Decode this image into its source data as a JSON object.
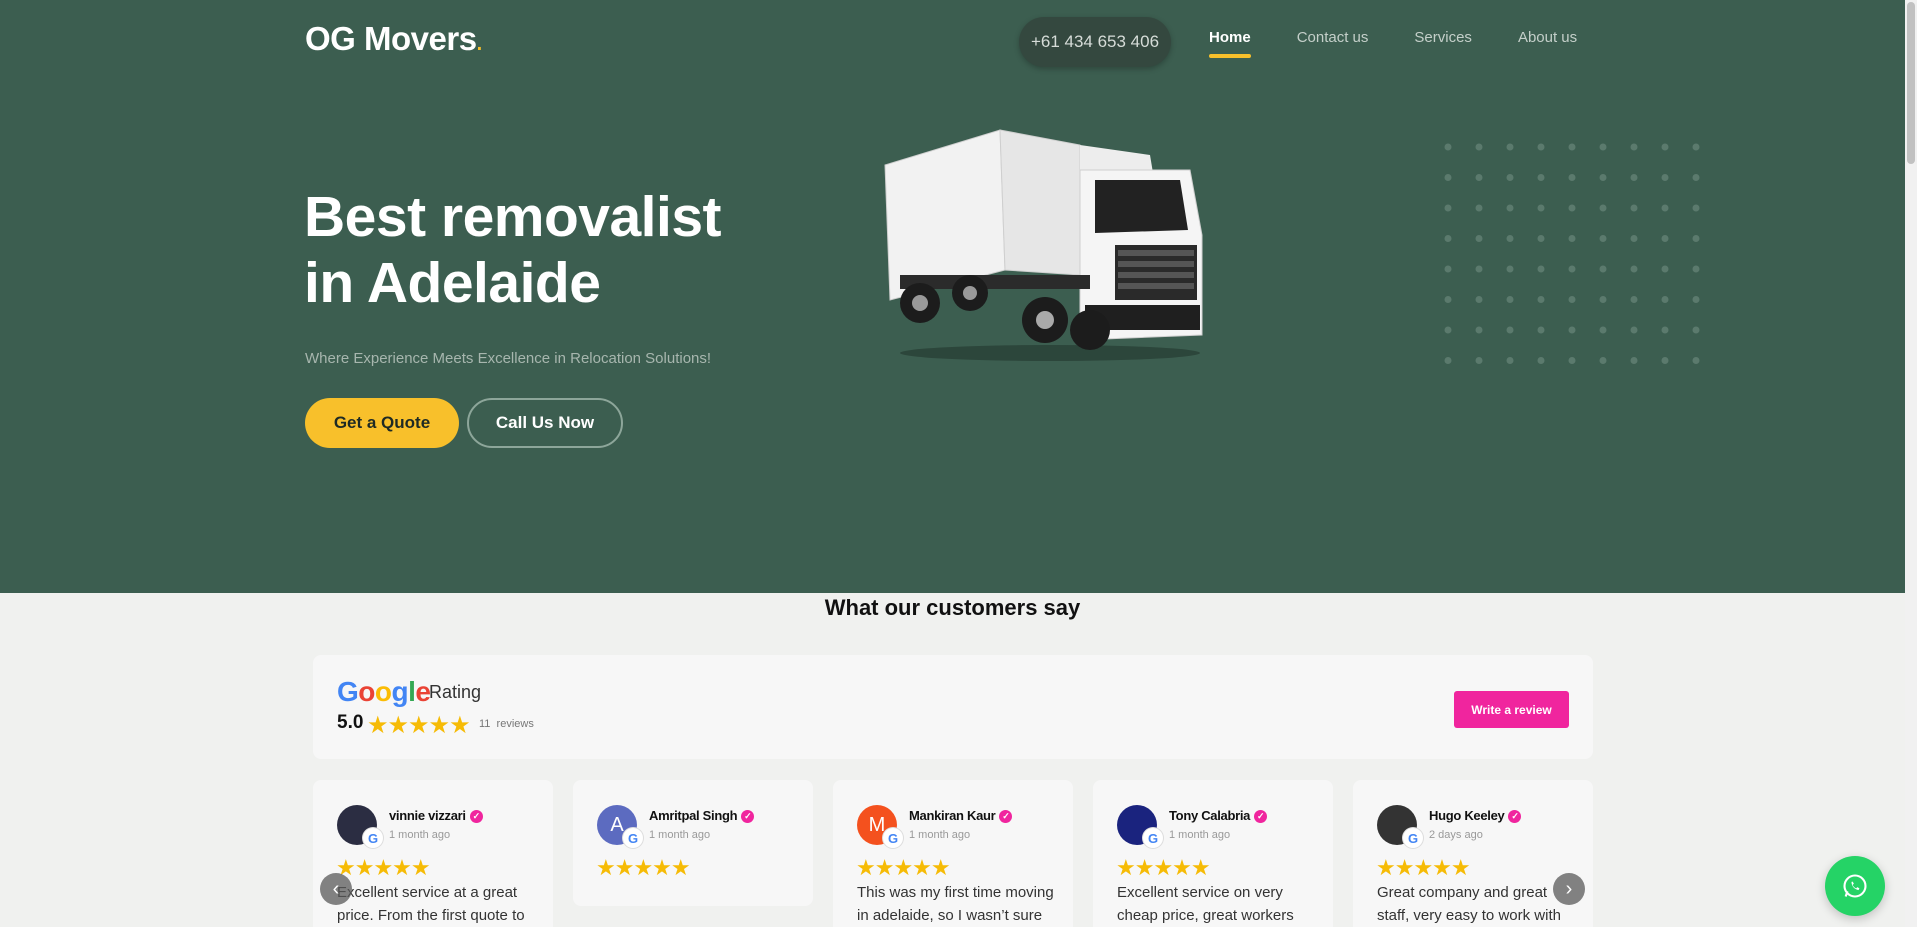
{
  "header": {
    "logo": "OG Movers",
    "logo_dot": ".",
    "phone": "+61 434 653 406",
    "nav": [
      {
        "label": "Home"
      },
      {
        "label": "Contact us"
      },
      {
        "label": "Services"
      },
      {
        "label": "About us"
      }
    ],
    "active_nav": "Home"
  },
  "hero": {
    "title_line1": "Best removalist",
    "title_line2": "in Adelaide",
    "subtitle": "Where Experience Meets Excellence in Relocation Solutions!",
    "primary_button": "Get a Quote",
    "secondary_button": "Call Us Now"
  },
  "reviews_section": {
    "title": "What our customers say",
    "google_logo": "Google",
    "rating_label": "Rating",
    "score": "5.0",
    "stars": "★★★★★",
    "review_count": "11",
    "reviews_label": "reviews",
    "write_review_button": "Write a review",
    "cards": [
      {
        "name": "vinnie vizzari",
        "date": "1 month ago",
        "stars": "★★★★★",
        "text": "Excellent service at a great price. From the first quote to",
        "avatar_letter": "",
        "avatar_color": "#2b2d42"
      },
      {
        "name": "Amritpal Singh",
        "date": "1 month ago",
        "stars": "★★★★★",
        "text": "",
        "avatar_letter": "A",
        "avatar_color": "#5c6bc0"
      },
      {
        "name": "Mankiran Kaur",
        "date": "1 month ago",
        "stars": "★★★★★",
        "text": "This was my first time moving in adelaide, so I wasn’t sure of",
        "avatar_letter": "M",
        "avatar_color": "#f4511e"
      },
      {
        "name": "Tony Calabria",
        "date": "1 month ago",
        "stars": "★★★★★",
        "text": "Excellent service on very cheap price, great workers",
        "avatar_letter": "",
        "avatar_color": "#1a237e"
      },
      {
        "name": "Hugo Keeley",
        "date": "2 days ago",
        "stars": "★★★★★",
        "text": "Great company and great staff, very easy to work with",
        "avatar_letter": "",
        "avatar_color": "#333333"
      }
    ]
  },
  "icons": {
    "prev": "chevron-left-icon",
    "next": "chevron-right-icon",
    "whatsapp": "whatsapp-icon",
    "verified": "verified-icon",
    "google_badge": "google-g-icon"
  },
  "colors": {
    "hero_bg": "#3c5e50",
    "accent_yellow": "#f8c02b",
    "review_pink": "#f0259e",
    "whatsapp_green": "#25d366",
    "star_gold": "#f6bb06"
  }
}
